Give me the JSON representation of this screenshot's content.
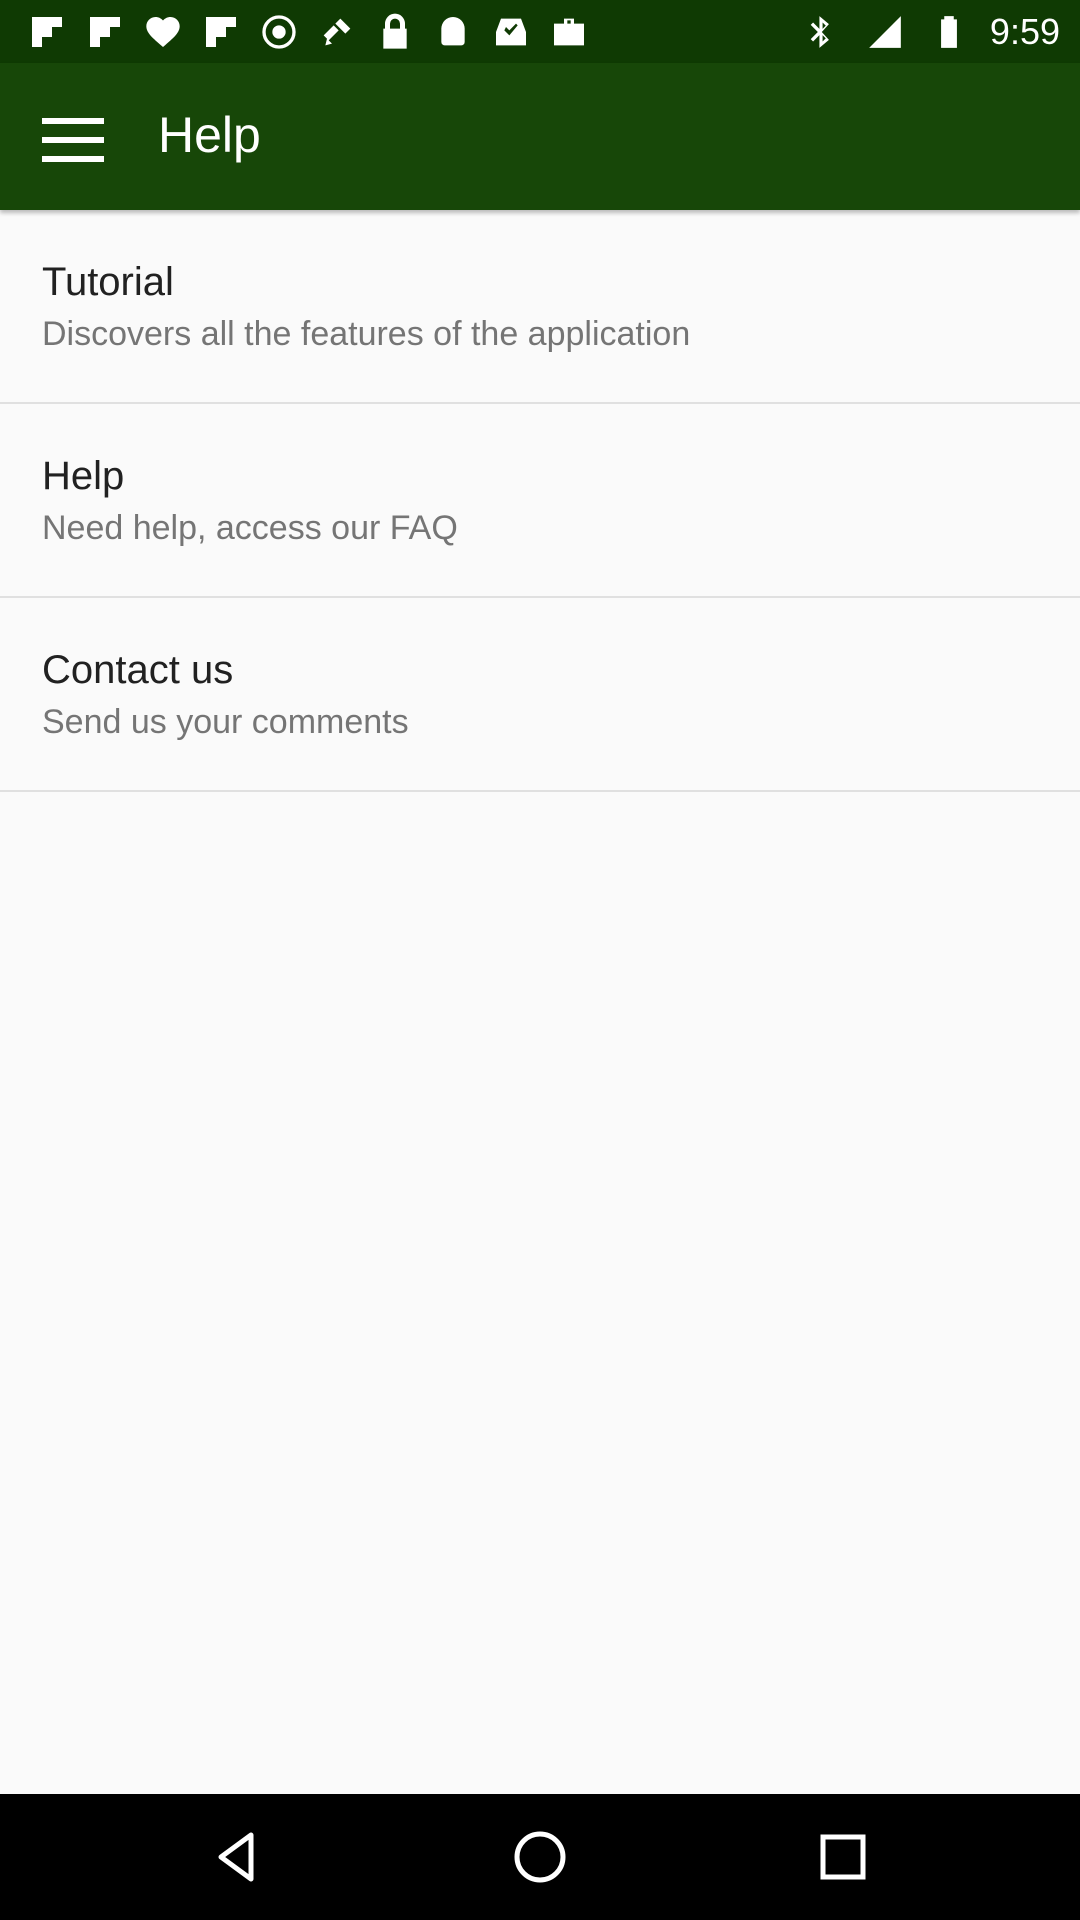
{
  "status_bar": {
    "time": "9:59",
    "left_icons": [
      "flipboard-icon",
      "flipboard-icon",
      "iheart-icon",
      "flipboard-icon",
      "gps-icon",
      "fake-gps-icon",
      "lock-icon",
      "android-icon",
      "inbox-icon",
      "briefcase-icon"
    ],
    "right_icons": [
      "bluetooth-icon",
      "signal-icon",
      "battery-icon"
    ]
  },
  "app_bar": {
    "title": "Help",
    "menu_icon": "menu-icon",
    "color": "#174708"
  },
  "items": [
    {
      "title": "Tutorial",
      "subtitle": "Discovers all the features of the application"
    },
    {
      "title": "Help",
      "subtitle": "Need help, access our FAQ"
    },
    {
      "title": "Contact us",
      "subtitle": "Send us your comments"
    }
  ],
  "nav_bar": {
    "buttons": [
      "back-icon",
      "home-icon",
      "recents-icon"
    ]
  }
}
